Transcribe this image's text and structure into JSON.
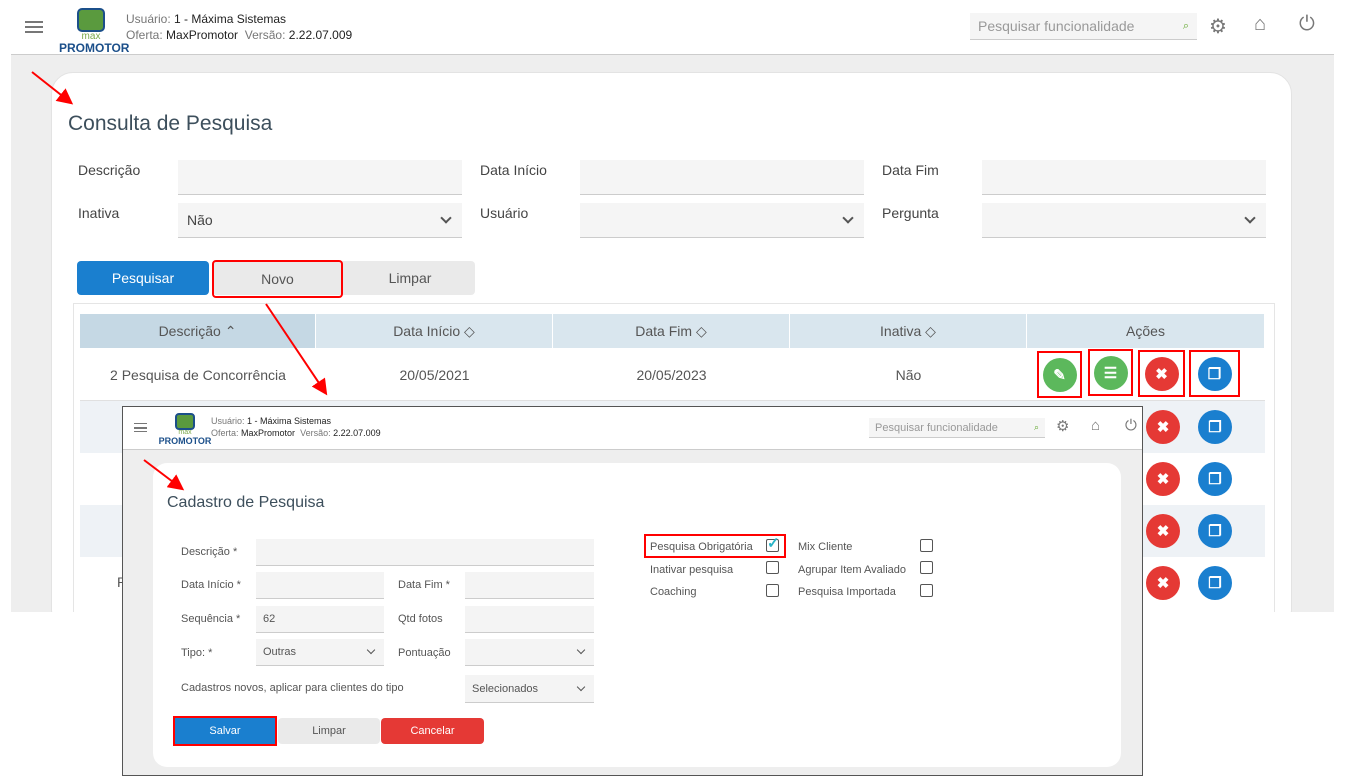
{
  "header": {
    "user_label": "Usuário:",
    "user": "1 - Máxima Sistemas",
    "offer_label": "Oferta:",
    "offer": "MaxPromotor",
    "version_label": "Versão:",
    "version": "2.22.07.009",
    "logo_top": "max",
    "logo_bottom": "PROMOTOR",
    "search_placeholder": "Pesquisar funcionalidade"
  },
  "page": {
    "title": "Consulta de Pesquisa",
    "filters": {
      "descricao": "Descrição",
      "data_inicio": "Data Início",
      "data_fim": "Data Fim",
      "inativa": "Inativa",
      "inativa_value": "Não",
      "usuario": "Usuário",
      "pergunta": "Pergunta"
    },
    "buttons": {
      "pesquisar": "Pesquisar",
      "novo": "Novo",
      "limpar": "Limpar"
    },
    "table": {
      "headers": [
        "Descrição",
        "Data Início",
        "Data Fim",
        "Inativa",
        "Ações"
      ],
      "rows": [
        {
          "descricao": "2 Pesquisa de Concorrência",
          "data_inicio": "20/05/2021",
          "data_fim": "20/05/2023",
          "inativa": "Não"
        }
      ],
      "partial_row_text": "P"
    }
  },
  "inset": {
    "header": {
      "user_label": "Usuário:",
      "user": "1 - Máxima Sistemas",
      "offer_label": "Oferta:",
      "offer": "MaxPromotor",
      "version_label": "Versão:",
      "version": "2.22.07.009",
      "logo_top": "max",
      "logo_bottom": "PROMOTOR",
      "search_placeholder": "Pesquisar funcionalidade"
    },
    "title": "Cadastro de Pesquisa",
    "fields": {
      "descricao": "Descrição *",
      "data_inicio": "Data Início *",
      "data_fim": "Data Fim *",
      "sequencia": "Sequência *",
      "sequencia_value": "62",
      "qtd_fotos": "Qtd fotos",
      "tipo": "Tipo: *",
      "tipo_value": "Outras",
      "pontuacao": "Pontuação",
      "cadastros": "Cadastros novos, aplicar para clientes do tipo",
      "cadastros_value": "Selecionados"
    },
    "checkboxes": [
      {
        "label": "Pesquisa Obrigatória",
        "checked": true
      },
      {
        "label": "Inativar pesquisa",
        "checked": false
      },
      {
        "label": "Coaching",
        "checked": false
      },
      {
        "label": "Mix Cliente",
        "checked": false
      },
      {
        "label": "Agrupar Item Avaliado",
        "checked": false
      },
      {
        "label": "Pesquisa Importada",
        "checked": false
      }
    ],
    "buttons": {
      "salvar": "Salvar",
      "limpar": "Limpar",
      "cancelar": "Cancelar"
    }
  },
  "colors": {
    "primary": "#1a7fcf",
    "success": "#5cb85c",
    "danger": "#e53935",
    "annotation": "#ff0000"
  }
}
